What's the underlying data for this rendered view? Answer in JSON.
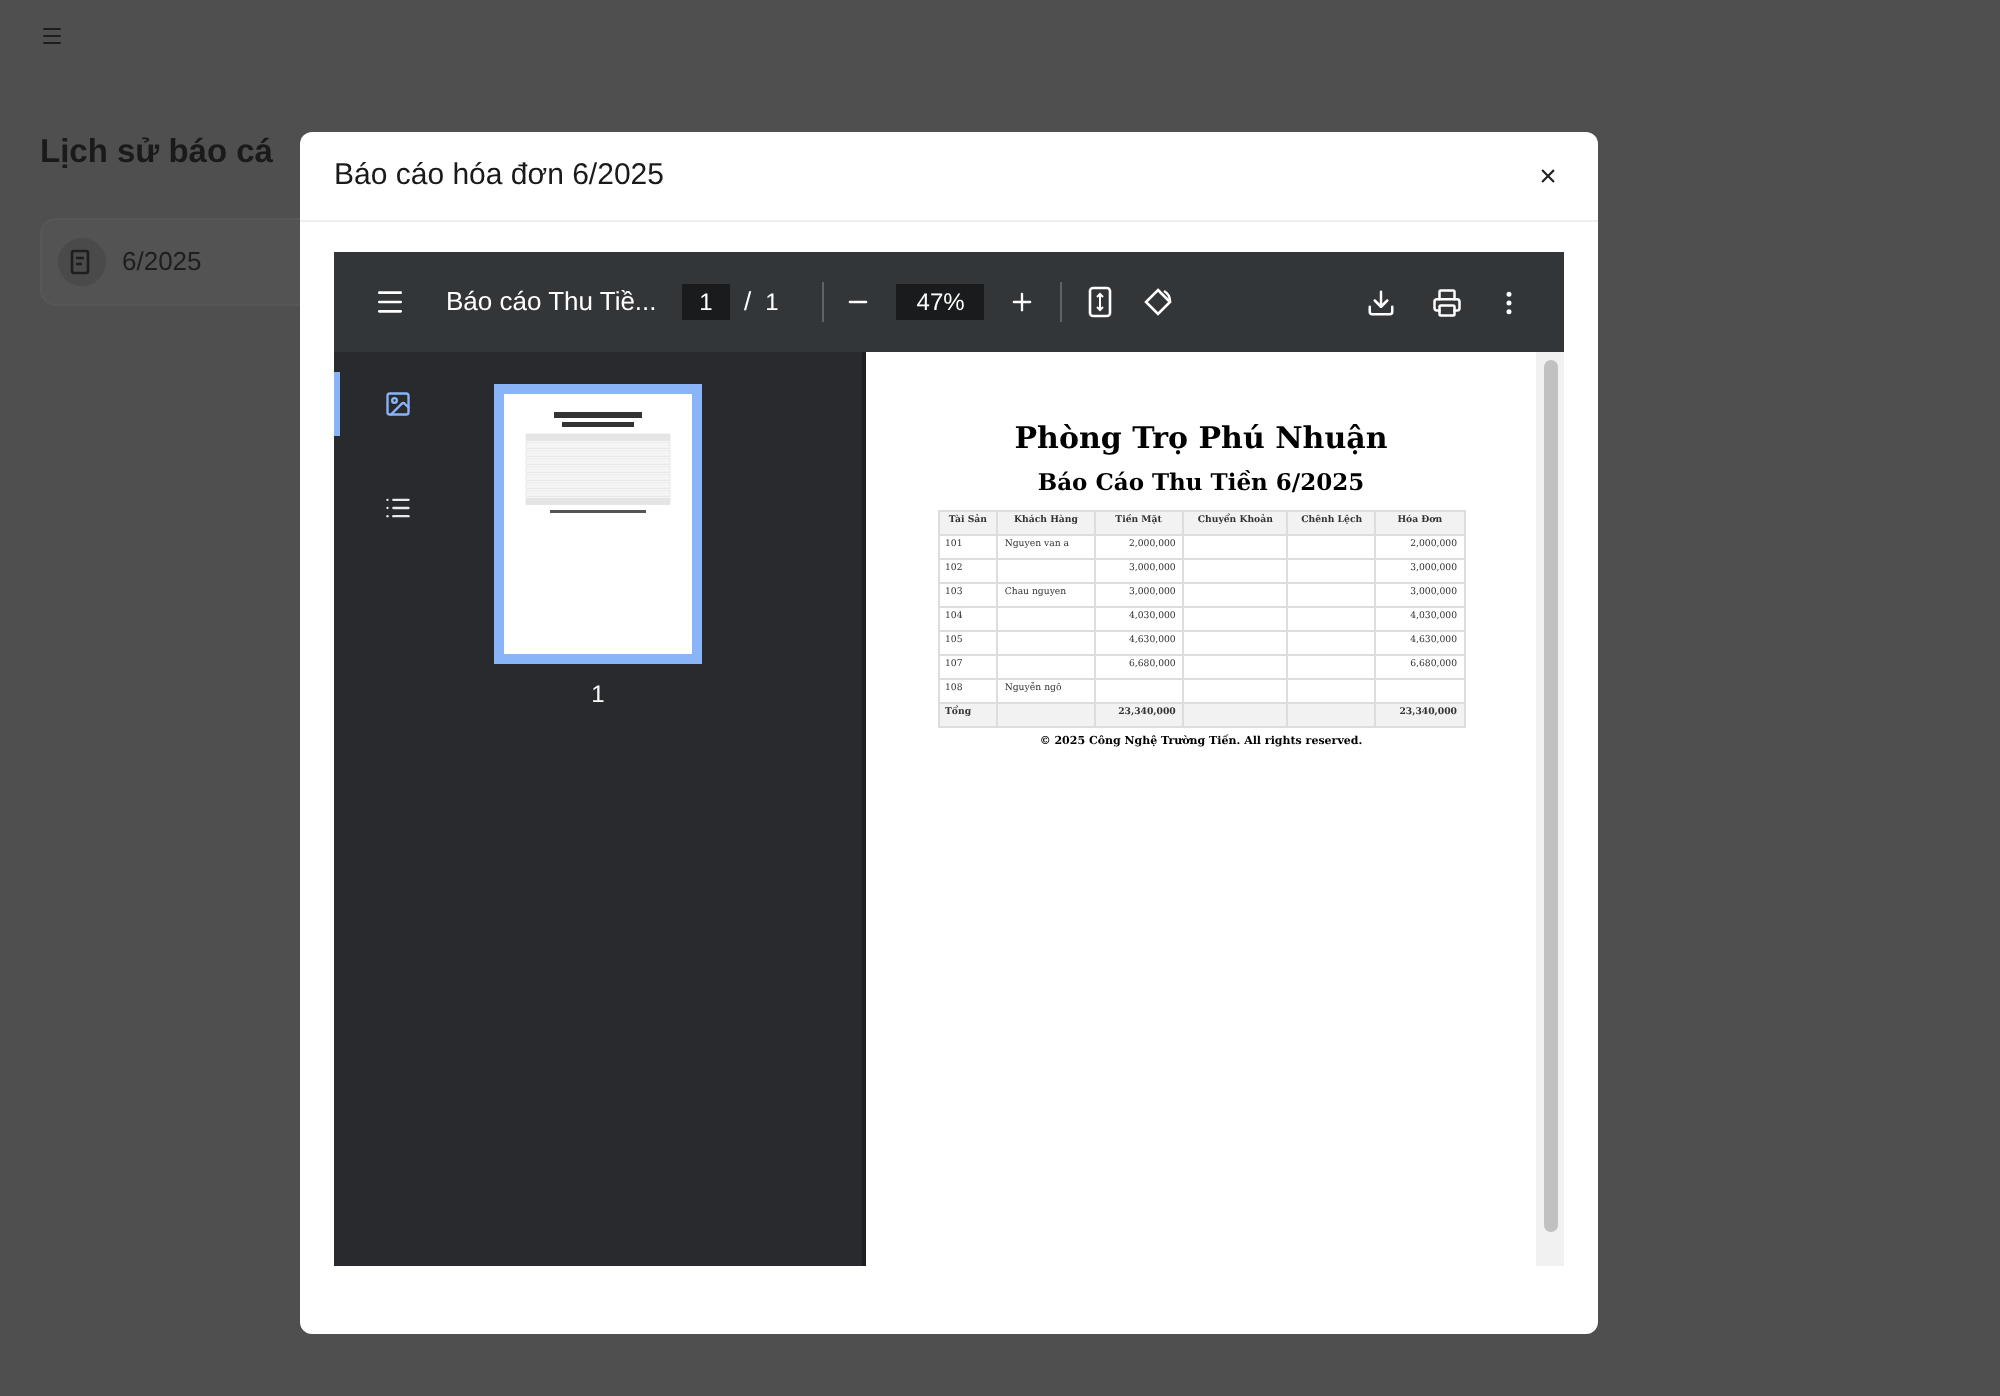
{
  "background": {
    "title": "Lịch sử báo cá",
    "card": {
      "label": "6/2025"
    }
  },
  "dialog": {
    "title": "Báo cáo hóa đơn 6/2025",
    "close": "×"
  },
  "viewer": {
    "doc_title": "Báo cáo Thu Tiề...",
    "page": "1",
    "page_count": "1",
    "separator": "/",
    "zoom": "47%",
    "sidebar_tabs": [
      {
        "kind": "thumbnails",
        "selected": true
      },
      {
        "kind": "outline",
        "selected": false
      }
    ],
    "thumbnail_label": "1",
    "document": {
      "heading": "Phòng Trọ Phú Nhuận",
      "subheading": "Báo Cáo Thu Tiền 6/2025",
      "columns": [
        "Tài Sản",
        "Khách Hàng",
        "Tiền Mặt",
        "Chuyển Khoản",
        "Chênh Lệch",
        "Hóa Đơn"
      ],
      "rows": [
        {
          "room": "101",
          "customer": "Nguyen van a",
          "cash": "2,000,000",
          "invoice": "2,000,000"
        },
        {
          "room": "102",
          "cash": "3,000,000",
          "invoice": "3,000,000"
        },
        {
          "room": "103",
          "customer": "Chau nguyen",
          "cash": "3,000,000",
          "invoice": "3,000,000"
        },
        {
          "room": "104",
          "cash": "4,030,000",
          "invoice": "4,030,000"
        },
        {
          "room": "105",
          "cash": "4,630,000",
          "invoice": "4,630,000"
        },
        {
          "room": "107",
          "cash": "6,680,000",
          "invoice": "6,680,000"
        },
        {
          "room": "108",
          "customer": "Nguyễn ngô"
        }
      ],
      "total": {
        "room": "Tổng",
        "cash": "23,340,000",
        "invoice": "23,340,000"
      },
      "footer": "© 2025 Công Nghệ Trường Tiến. All rights reserved."
    }
  }
}
